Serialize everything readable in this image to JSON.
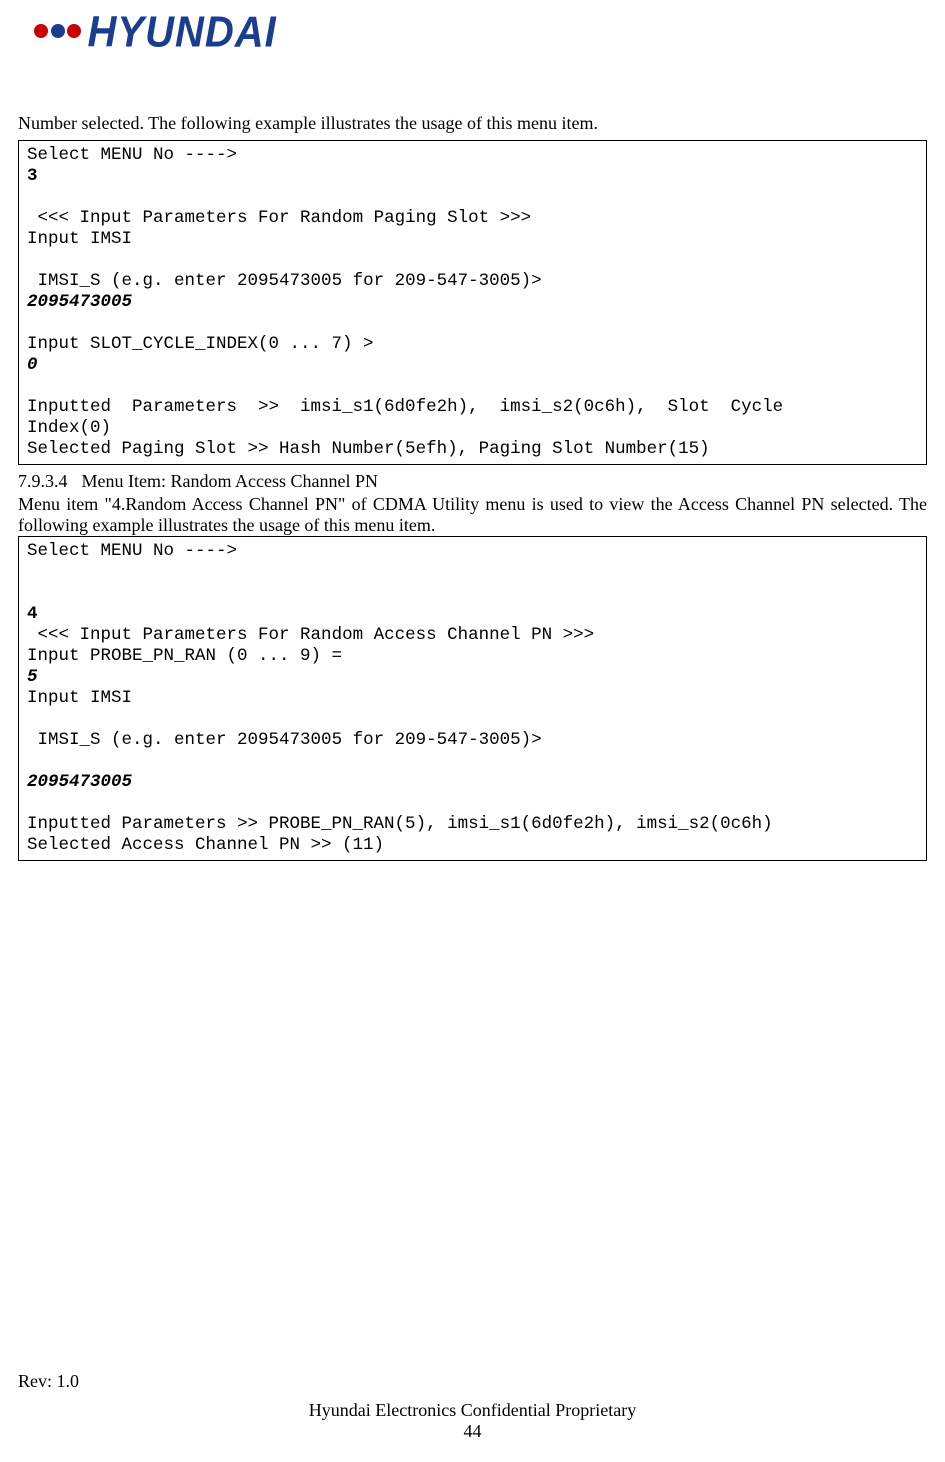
{
  "logo": {
    "text": "HYUNDAI"
  },
  "intro_text": "Number selected. The following example illustrates the usage of this menu item.",
  "code1": {
    "line1": "Select MENU No ---->",
    "input1": "3",
    "line2": " <<< Input Parameters For Random Paging Slot >>>",
    "line3": "Input IMSI",
    "line4": " IMSI_S (e.g. enter 2095473005 for 209-547-3005)>",
    "input2": "2095473005",
    "line5": "Input SLOT_CYCLE_INDEX(0 ... 7) >",
    "input3": "0",
    "line6a": "Inputted  Parameters  >>  imsi_s1(6d0fe2h),  imsi_s2(0c6h),  Slot  Cycle",
    "line6b": "Index(0)",
    "line7": "Selected Paging Slot >> Hash Number(5efh), Paging Slot Number(15)"
  },
  "section": {
    "number": "7.9.3.4",
    "title": "Menu Item: Random Access Channel PN",
    "body": "Menu item \"4.Random Access Channel PN\" of CDMA Utility menu is used to view the Access Channel PN selected. The following example illustrates the usage of this menu item."
  },
  "code2": {
    "line1": "Select MENU No ---->",
    "input1": "4",
    "line2": " <<< Input Parameters For Random Access Channel PN >>>",
    "line3": "Input PROBE_PN_RAN (0 ... 9) =",
    "input2": "5",
    "line4": "Input IMSI",
    "line5": " IMSI_S (e.g. enter 2095473005 for 209-547-3005)>",
    "input3": "2095473005",
    "line6": "Inputted Parameters >> PROBE_PN_RAN(5), imsi_s1(6d0fe2h), imsi_s2(0c6h)",
    "line7": "Selected Access Channel PN >> (11)"
  },
  "footer": {
    "rev": "Rev: 1.0",
    "proprietary": "Hyundai Electronics Confidential Proprietary",
    "page": "44"
  }
}
